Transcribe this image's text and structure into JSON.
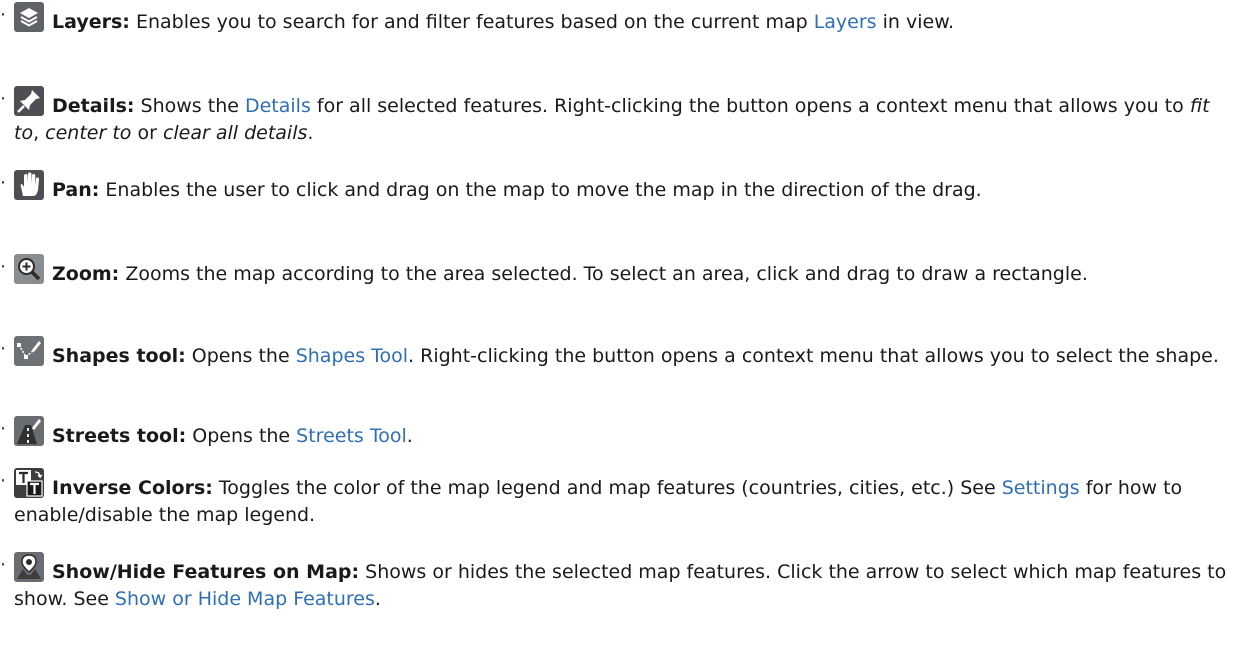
{
  "bullet": "·",
  "items": [
    {
      "icon": "layers-icon",
      "term": "Layers:",
      "text_a": " Enables you to search for and filter features based on the current map ",
      "link": "Layers",
      "text_b": " in view."
    },
    {
      "icon": "pin-icon",
      "term": "Details:",
      "text_a": " Shows the ",
      "link": "Details",
      "text_b": " for all selected features. Right-clicking the button opens a context menu that allows you to ",
      "em1": "fit to",
      "sep1": ", ",
      "em2": "center to",
      "sep2": " or ",
      "em3": "clear all details",
      "end": "."
    },
    {
      "icon": "hand-icon",
      "term": "Pan:",
      "text_a": " Enables the user to click and drag on the map to move the map in the direction of the drag."
    },
    {
      "icon": "zoom-icon",
      "term": "Zoom:",
      "text_a": " Zooms the map according to the area selected. To select an area, click and drag to draw a rectangle."
    },
    {
      "icon": "shapes-icon",
      "term": "Shapes tool:",
      "text_a": " Opens the ",
      "link": "Shapes Tool",
      "text_b": ". Right-clicking the button opens a context menu that allows you to select the shape."
    },
    {
      "icon": "streets-icon",
      "term": "Streets tool:",
      "text_a": " Opens the ",
      "link": "Streets Tool",
      "text_b": "."
    },
    {
      "icon": "inverse-colors-icon",
      "term": "Inverse Colors:",
      "text_a": " Toggles the color of the map legend and map features (countries, cities, etc.) See ",
      "link": "Settings",
      "text_b": " for how to enable/disable the map legend."
    },
    {
      "icon": "map-marker-icon",
      "term": "Show/Hide Features on Map:",
      "text_a": " Shows or hides the selected map features. Click the arrow to select which map features to show. See ",
      "link": "Show or Hide Map Features",
      "text_b": "."
    }
  ],
  "colors": {
    "link": "#2e6fb7",
    "icon_bg": "#5a5a5a"
  }
}
